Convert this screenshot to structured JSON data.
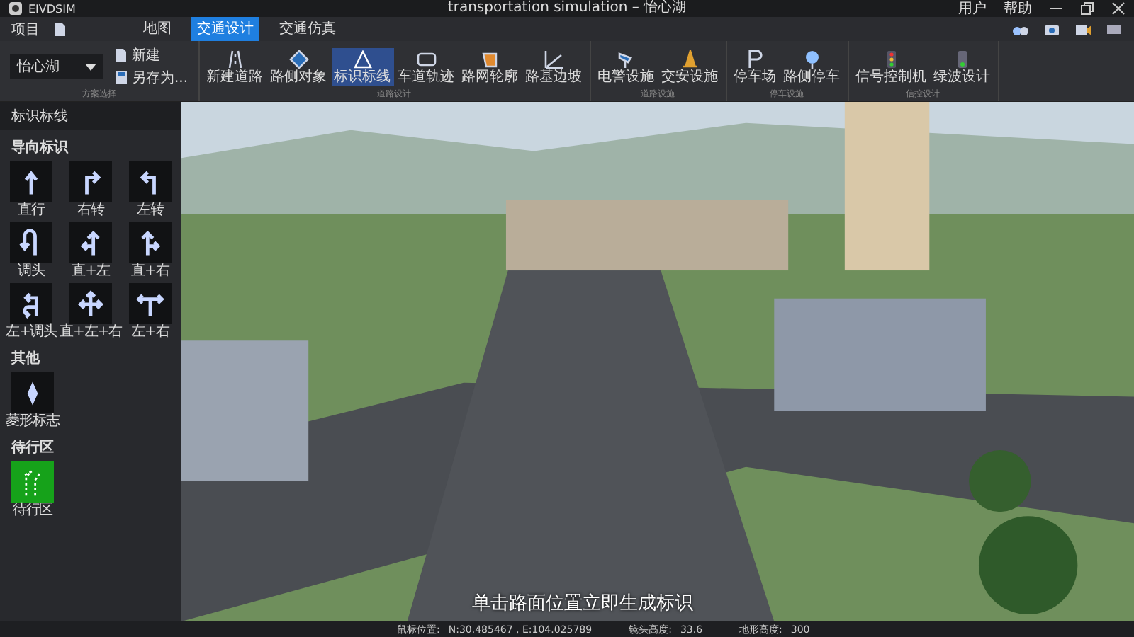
{
  "window": {
    "app_name": "EIVDSIM",
    "title": "transportation simulation – 怡心湖",
    "user_menu": "用户",
    "help_menu": "帮助"
  },
  "menu": {
    "project": "项目",
    "tabs": [
      {
        "label": "地图",
        "selected": false
      },
      {
        "label": "交通设计",
        "selected": true
      },
      {
        "label": "交通仿真",
        "selected": false
      }
    ]
  },
  "ribbon": {
    "scheme": {
      "dropdown_value": "怡心湖",
      "new": "新建",
      "save_as": "另存为...",
      "group_label": "方案选择"
    },
    "groups": [
      {
        "label": "道路设计",
        "tools": [
          {
            "label": "新建道路",
            "kind": "road",
            "selected": false
          },
          {
            "label": "路侧对象",
            "kind": "diamond",
            "selected": false
          },
          {
            "label": "标识标线",
            "kind": "triangle",
            "selected": true
          },
          {
            "label": "车道轨迹",
            "kind": "vehicle",
            "selected": false
          },
          {
            "label": "路网轮廓",
            "kind": "outline",
            "selected": false
          },
          {
            "label": "路基边坡",
            "kind": "slope",
            "selected": false
          }
        ]
      },
      {
        "label": "道路设施",
        "tools": [
          {
            "label": "电警设施",
            "kind": "camera",
            "selected": false
          },
          {
            "label": "交安设施",
            "kind": "cone",
            "selected": false
          }
        ]
      },
      {
        "label": "停车设施",
        "tools": [
          {
            "label": "停车场",
            "kind": "parking",
            "selected": false
          },
          {
            "label": "路侧停车",
            "kind": "pin",
            "selected": false
          }
        ]
      },
      {
        "label": "信控设计",
        "tools": [
          {
            "label": "信号控制机",
            "kind": "signal",
            "selected": false
          },
          {
            "label": "绿波设计",
            "kind": "green-signal",
            "selected": false
          }
        ]
      }
    ]
  },
  "panel": {
    "title": "标识标线",
    "sections": [
      {
        "title": "导向标识",
        "items": [
          {
            "label": "直行",
            "kind": "straight"
          },
          {
            "label": "右转",
            "kind": "right"
          },
          {
            "label": "左转",
            "kind": "left"
          },
          {
            "label": "调头",
            "kind": "uturn"
          },
          {
            "label": "直+左",
            "kind": "straight-left"
          },
          {
            "label": "直+右",
            "kind": "straight-right"
          },
          {
            "label": "左+调头",
            "kind": "left-uturn"
          },
          {
            "label": "直+左+右",
            "kind": "all"
          },
          {
            "label": "左+右",
            "kind": "left-right"
          }
        ]
      },
      {
        "title": "其他",
        "items": [
          {
            "label": "菱形标志",
            "kind": "diamond"
          }
        ]
      },
      {
        "title": "待行区",
        "items": [
          {
            "label": "待行区",
            "kind": "waiting"
          }
        ]
      }
    ]
  },
  "viewport": {
    "hint": "单击路面位置立即生成标识"
  },
  "status_bar": {
    "mouse_label": "鼠标位置:",
    "mouse_value": "N:30.485467 , E:104.025789",
    "camera_label": "镜头高度:",
    "camera_value": "33.6",
    "terrain_label": "地形高度:",
    "terrain_value": "300"
  }
}
